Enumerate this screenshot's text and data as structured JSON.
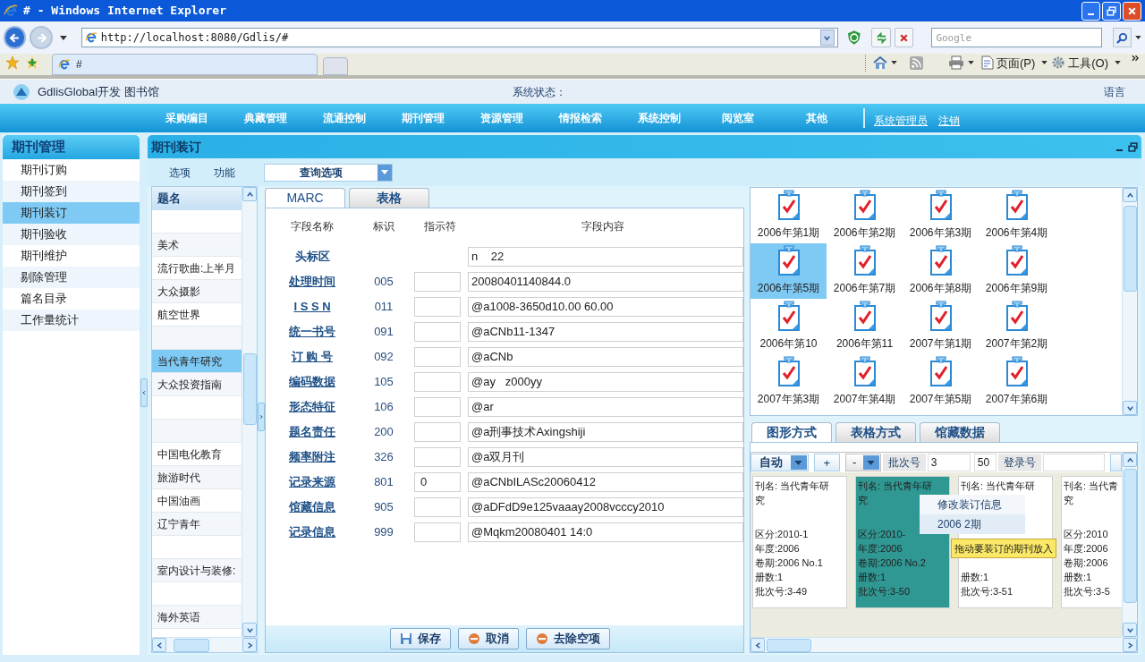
{
  "window": {
    "title": "# - Windows Internet Explorer"
  },
  "browser": {
    "address": "http://localhost:8080/Gdlis/#",
    "search_placeholder": "Google",
    "tabs": [
      {
        "label": "#",
        "selected": true
      }
    ],
    "command_bar": [
      {
        "kind": "home"
      },
      {
        "kind": "feed"
      },
      {
        "kind": "print"
      },
      {
        "kind": "page",
        "label": "页面(P)"
      },
      {
        "kind": "tools",
        "label": "工具(O)"
      }
    ]
  },
  "app": {
    "title": "GdlisGlobal开发 图书馆",
    "status_label": "系统状态：",
    "language": "语言"
  },
  "nav": {
    "menus": [
      "采购编目",
      "典藏管理",
      "流通控制",
      "期刊管理",
      "资源管理",
      "情报检索",
      "系统控制",
      "阅览室",
      "其他"
    ],
    "user": "系统管理员",
    "logout": "注销"
  },
  "sidebar": {
    "title": "期刊管理",
    "items": [
      {
        "label": "期刊订购",
        "selected": false
      },
      {
        "label": "期刊签到",
        "selected": false
      },
      {
        "label": "期刊装订",
        "selected": true
      },
      {
        "label": "期刊验收",
        "selected": false
      },
      {
        "label": "期刊维护",
        "selected": false
      },
      {
        "label": "剔除管理",
        "selected": false
      },
      {
        "label": "篇名目录",
        "selected": false
      },
      {
        "label": "工作量统计",
        "selected": false
      }
    ]
  },
  "panel": {
    "title": "期刊装订",
    "toolbar": [
      "选项",
      "功能"
    ],
    "query": "查询选项"
  },
  "title_list": {
    "header": "题名",
    "rows": [
      {
        "selected": false
      },
      {
        "title": "美术",
        "selected": false
      },
      {
        "title": "流行歌曲:上半月",
        "selected": false
      },
      {
        "title": "大众摄影",
        "selected": false
      },
      {
        "title": "航空世界",
        "selected": false
      },
      {
        "selected": false
      },
      {
        "title": "当代青年研究",
        "selected": true
      },
      {
        "title": "大众投资指南",
        "selected": false
      },
      {
        "selected": false
      },
      {
        "selected": false
      },
      {
        "title": "中国电化教育",
        "selected": false
      },
      {
        "title": "旅游时代",
        "selected": false
      },
      {
        "title": "中国油画",
        "selected": false
      },
      {
        "title": "辽宁青年",
        "selected": false
      },
      {
        "selected": false
      },
      {
        "title": "室内设计与装修:",
        "selected": false
      },
      {
        "selected": false
      },
      {
        "title": "海外英语",
        "selected": false
      }
    ]
  },
  "marc": {
    "tabs": [
      {
        "label": "MARC",
        "selected": true
      },
      {
        "label": "表格",
        "selected": false
      }
    ],
    "columns": [
      "字段名称",
      "标识",
      "指示符",
      "字段内容"
    ],
    "rows": [
      {
        "kind": "leader",
        "name": "头标区",
        "content": "n    22"
      },
      {
        "kind": "field",
        "name": "处理时间",
        "tag": "005",
        "content": "20080401140844.0"
      },
      {
        "kind": "field",
        "name": "I S S N",
        "tag": "011",
        "content": "@a1008-3650d10.00 60.00"
      },
      {
        "kind": "field",
        "name": "统一书号",
        "tag": "091",
        "content": "@aCNb11-1347"
      },
      {
        "kind": "field",
        "name": "订 购 号",
        "tag": "092",
        "content": "@aCNb"
      },
      {
        "kind": "field",
        "name": "编码数据",
        "tag": "105",
        "content": "@ay   z000yy"
      },
      {
        "kind": "field",
        "name": "形态特征",
        "tag": "106",
        "content": "@ar"
      },
      {
        "kind": "field",
        "name": "题名责任",
        "tag": "200",
        "content": "@a刑事技术Axingshiji"
      },
      {
        "kind": "field",
        "name": "频率附注",
        "tag": "326",
        "content": "@a双月刊"
      },
      {
        "kind": "field",
        "name": "记录来源",
        "tag": "801",
        "indicator": "0",
        "content": "@aCNbILASc20060412"
      },
      {
        "kind": "field",
        "name": "馆藏信息",
        "tag": "905",
        "content": "@aDFdD9e125vaaay2008vcccy2010"
      },
      {
        "kind": "field",
        "name": "记录信息",
        "tag": "999",
        "content": "@Mqkm20080401 14:0"
      }
    ],
    "buttons": [
      {
        "kind": "save",
        "label": "保存"
      },
      {
        "kind": "cancel",
        "label": "取消"
      },
      {
        "kind": "cancel",
        "label": "去除空项"
      }
    ]
  },
  "issues": {
    "items": [
      {
        "label": "2006年第1期",
        "selected": false
      },
      {
        "label": "2006年第2期",
        "selected": false
      },
      {
        "label": "2006年第3期",
        "selected": false
      },
      {
        "label": "2006年第4期",
        "selected": false
      },
      {
        "label": "2006年第5期",
        "selected": true
      },
      {
        "label": "2006年第7期",
        "selected": false
      },
      {
        "label": "2006年第8期",
        "selected": false
      },
      {
        "label": "2006年第9期",
        "selected": false
      },
      {
        "label": "2006年第10",
        "selected": false
      },
      {
        "label": "2006年第11",
        "selected": false
      },
      {
        "label": "2007年第1期",
        "selected": false
      },
      {
        "label": "2007年第2期",
        "selected": false
      },
      {
        "label": "2007年第3期",
        "selected": false
      },
      {
        "label": "2007年第4期",
        "selected": false
      },
      {
        "label": "2007年第5期",
        "selected": false
      },
      {
        "label": "2007年第6期",
        "selected": false
      }
    ]
  },
  "binding": {
    "tabs": [
      {
        "label": "图形方式",
        "selected": true
      },
      {
        "label": "表格方式",
        "selected": false
      },
      {
        "label": "馆藏数据",
        "selected": false
      }
    ],
    "mode": "自动",
    "plus": "+",
    "minus": "-",
    "batch_label": "批次号",
    "batch_value": "3",
    "batch_count": "50",
    "reg_label": "登录号",
    "cards": [
      {
        "title_lines": [
          "刊名: 当代青年研",
          "究"
        ],
        "lines": [
          "区分:2010-1",
          "年度:2006",
          "卷期:2006 No.1",
          "册数:1",
          "批次号:3-49"
        ],
        "selected": false
      },
      {
        "title_lines": [
          "刊名: 当代青年研",
          "究"
        ],
        "lines": [
          "区分:2010-",
          "年度:2006",
          "卷期:2006 No.2",
          "册数:1",
          "批次号:3-50"
        ],
        "selected": true
      },
      {
        "title_lines": [
          "刊名: 当代青年研"
        ],
        "lines": [
          "册数:1",
          "批次号:3-51"
        ],
        "selected": false
      },
      {
        "title_lines": [
          "刊名: 当代青",
          "究"
        ],
        "lines": [
          "区分:2010",
          "年度:2006",
          "卷期:2006",
          "册数:1",
          "批次号:3-5"
        ],
        "selected": false
      }
    ],
    "context_menu": [
      {
        "label": "修改装订信息",
        "selected": false
      },
      {
        "label": "2006 2期",
        "selected": true
      }
    ],
    "tooltip": "拖动要装订的期刊放入"
  }
}
